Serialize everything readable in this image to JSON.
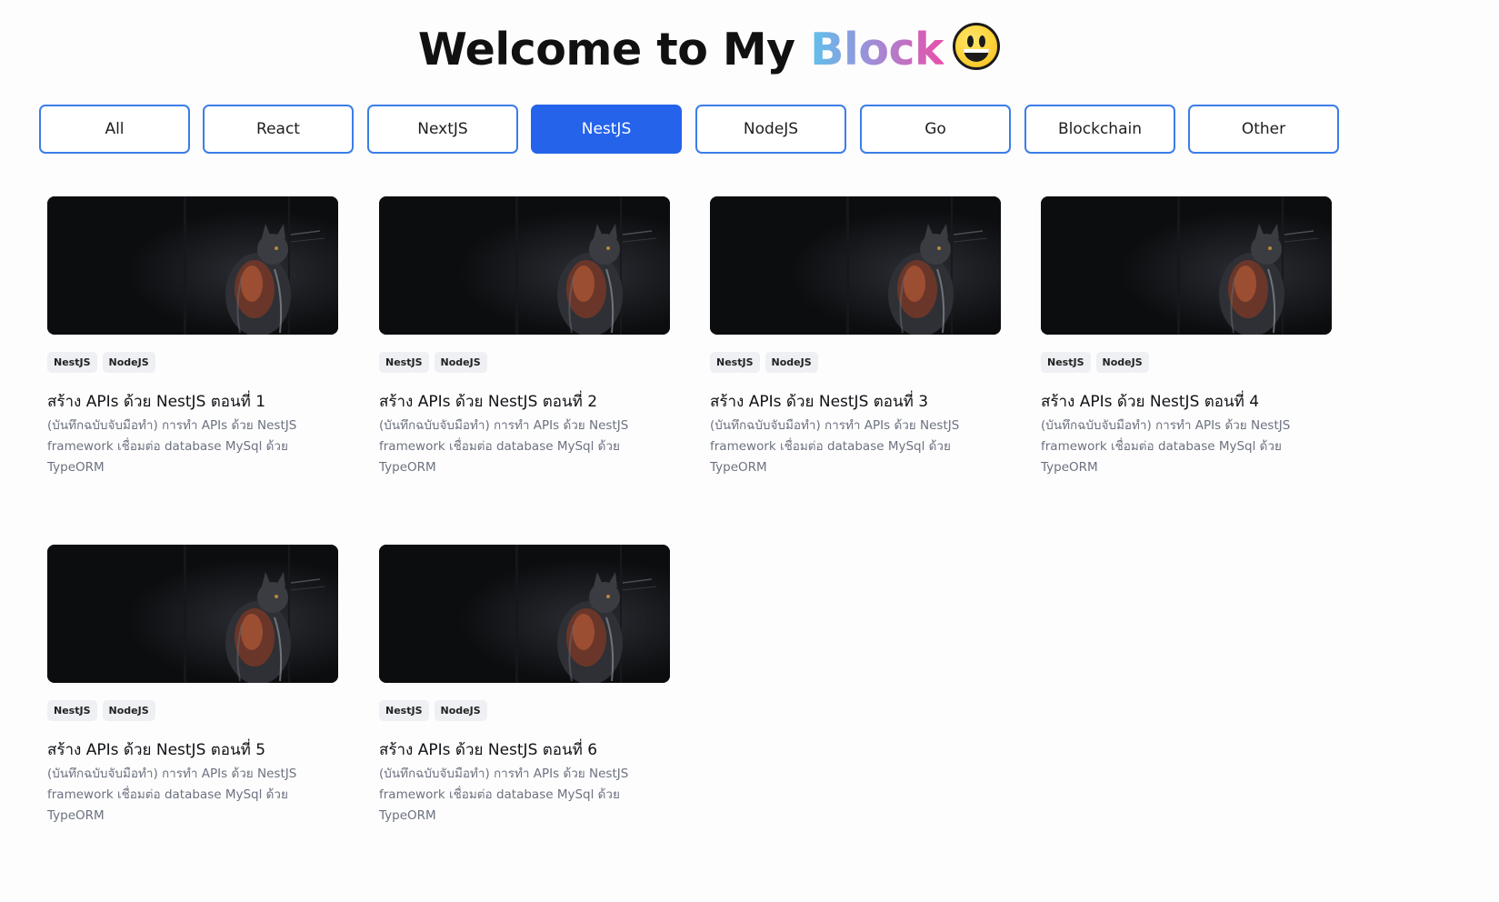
{
  "header": {
    "title_prefix": "Welcome to My ",
    "title_brand": "Block",
    "emoji_icon": "grinning-face-emoji"
  },
  "filters": [
    {
      "label": "All",
      "active": false
    },
    {
      "label": "React",
      "active": false
    },
    {
      "label": "NextJS",
      "active": false
    },
    {
      "label": "NestJS",
      "active": true
    },
    {
      "label": "NodeJS",
      "active": false
    },
    {
      "label": "Go",
      "active": false
    },
    {
      "label": "Blockchain",
      "active": false
    },
    {
      "label": "Other",
      "active": false
    }
  ],
  "colors": {
    "accent": "#2563eb",
    "button_border": "#3b7de8",
    "brand_gradient": [
      "#5fc1ec",
      "#9d8fd8",
      "#e84fa9"
    ]
  },
  "posts": [
    {
      "image": "cat-photo",
      "tags": [
        "NestJS",
        "NodeJS"
      ],
      "title": "สร้าง APIs ด้วย NestJS ตอนที่ 1",
      "description": "(บันทึกฉบับจับมือทำ) การทำ APIs ด้วย NestJS framework เชื่อมต่อ database MySql ด้วย TypeORM"
    },
    {
      "image": "cat-photo",
      "tags": [
        "NestJS",
        "NodeJS"
      ],
      "title": "สร้าง APIs ด้วย NestJS ตอนที่ 2",
      "description": "(บันทึกฉบับจับมือทำ) การทำ APIs ด้วย NestJS framework เชื่อมต่อ database MySql ด้วย TypeORM"
    },
    {
      "image": "cat-photo",
      "tags": [
        "NestJS",
        "NodeJS"
      ],
      "title": "สร้าง APIs ด้วย NestJS ตอนที่ 3",
      "description": "(บันทึกฉบับจับมือทำ) การทำ APIs ด้วย NestJS framework เชื่อมต่อ database MySql ด้วย TypeORM"
    },
    {
      "image": "cat-photo",
      "tags": [
        "NestJS",
        "NodeJS"
      ],
      "title": "สร้าง APIs ด้วย NestJS ตอนที่ 4",
      "description": "(บันทึกฉบับจับมือทำ) การทำ APIs ด้วย NestJS framework เชื่อมต่อ database MySql ด้วย TypeORM"
    },
    {
      "image": "cat-photo",
      "tags": [
        "NestJS",
        "NodeJS"
      ],
      "title": "สร้าง APIs ด้วย NestJS ตอนที่ 5",
      "description": "(บันทึกฉบับจับมือทำ) การทำ APIs ด้วย NestJS framework เชื่อมต่อ database MySql ด้วย TypeORM"
    },
    {
      "image": "cat-photo",
      "tags": [
        "NestJS",
        "NodeJS"
      ],
      "title": "สร้าง APIs ด้วย NestJS ตอนที่ 6",
      "description": "(บันทึกฉบับจับมือทำ) การทำ APIs ด้วย NestJS framework เชื่อมต่อ database MySql ด้วย TypeORM"
    }
  ]
}
